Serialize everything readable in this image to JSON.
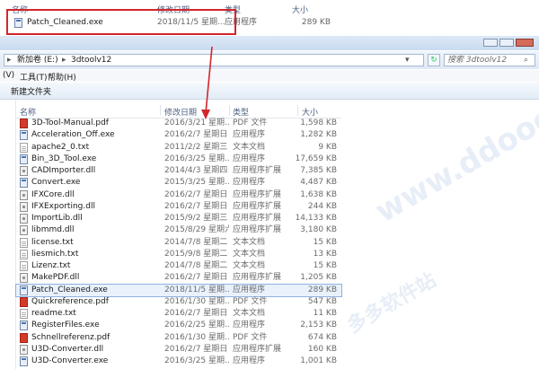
{
  "top_window": {
    "columns": {
      "name": "名称",
      "modified": "修改日期",
      "type": "类型",
      "size": "大小"
    },
    "file": {
      "name": "Patch_Cleaned.exe",
      "modified": "2018/11/5 星期...",
      "type": "应用程序",
      "size": "289 KB",
      "icon": "exe-icon"
    }
  },
  "address_bar": {
    "path": [
      "新加卷 (E:)",
      "3dtoolv12"
    ],
    "search_placeholder": "搜索 3dtoolv12"
  },
  "menu": {
    "view": "(V)",
    "tools": "工具(T)",
    "help": "帮助(H)"
  },
  "toolbar": {
    "new_folder": "新建文件夹"
  },
  "columns": {
    "name": "名称",
    "modified": "修改日期",
    "type": "类型",
    "size": "大小"
  },
  "files": [
    {
      "name": "3D-Tool-Manual.pdf",
      "modified": "2016/3/21 星期...",
      "type": "PDF 文件",
      "size": "1,598 KB",
      "icon": "pdf"
    },
    {
      "name": "Acceleration_Off.exe",
      "modified": "2016/2/7 星期日 ...",
      "type": "应用程序",
      "size": "1,282 KB",
      "icon": "exe"
    },
    {
      "name": "apache2_0.txt",
      "modified": "2011/2/2 星期三 ...",
      "type": "文本文档",
      "size": "9 KB",
      "icon": "txt"
    },
    {
      "name": "Bin_3D_Tool.exe",
      "modified": "2016/3/25 星期...",
      "type": "应用程序",
      "size": "17,659 KB",
      "icon": "exe"
    },
    {
      "name": "CADImporter.dll",
      "modified": "2014/4/3 星期四 ...",
      "type": "应用程序扩展",
      "size": "7,385 KB",
      "icon": "dll"
    },
    {
      "name": "Convert.exe",
      "modified": "2015/3/25 星期...",
      "type": "应用程序",
      "size": "4,487 KB",
      "icon": "exe"
    },
    {
      "name": "IFXCore.dll",
      "modified": "2016/2/7 星期日 ...",
      "type": "应用程序扩展",
      "size": "1,638 KB",
      "icon": "dll"
    },
    {
      "name": "IFXExporting.dll",
      "modified": "2016/2/7 星期日 ...",
      "type": "应用程序扩展",
      "size": "244 KB",
      "icon": "dll"
    },
    {
      "name": "ImportLib.dll",
      "modified": "2015/9/2 星期三 ...",
      "type": "应用程序扩展",
      "size": "14,133 KB",
      "icon": "dll"
    },
    {
      "name": "libmmd.dll",
      "modified": "2015/8/29 星期六 ...",
      "type": "应用程序扩展",
      "size": "3,180 KB",
      "icon": "dll"
    },
    {
      "name": "license.txt",
      "modified": "2014/7/8 星期二 ...",
      "type": "文本文档",
      "size": "15 KB",
      "icon": "txt"
    },
    {
      "name": "liesmich.txt",
      "modified": "2015/9/8 星期二 ...",
      "type": "文本文档",
      "size": "13 KB",
      "icon": "txt"
    },
    {
      "name": "Lizenz.txt",
      "modified": "2014/7/8 星期二 ...",
      "type": "文本文档",
      "size": "15 KB",
      "icon": "txt"
    },
    {
      "name": "MakePDF.dll",
      "modified": "2016/2/7 星期日 ...",
      "type": "应用程序扩展",
      "size": "1,205 KB",
      "icon": "dll"
    },
    {
      "name": "Patch_Cleaned.exe",
      "modified": "2018/11/5 星期...",
      "type": "应用程序",
      "size": "289 KB",
      "icon": "exe",
      "highlighted": true
    },
    {
      "name": "Quickreference.pdf",
      "modified": "2016/1/30 星期...",
      "type": "PDF 文件",
      "size": "547 KB",
      "icon": "pdf"
    },
    {
      "name": "readme.txt",
      "modified": "2016/2/7 星期日 ...",
      "type": "文本文档",
      "size": "11 KB",
      "icon": "txt"
    },
    {
      "name": "RegisterFiles.exe",
      "modified": "2016/2/25 星期...",
      "type": "应用程序",
      "size": "2,153 KB",
      "icon": "exe"
    },
    {
      "name": "Schnellreferenz.pdf",
      "modified": "2016/1/30 星期...",
      "type": "PDF 文件",
      "size": "674 KB",
      "icon": "pdf"
    },
    {
      "name": "U3D-Converter.dll",
      "modified": "2016/2/7 星期日 ...",
      "type": "应用程序扩展",
      "size": "160 KB",
      "icon": "dll"
    },
    {
      "name": "U3D-Converter.exe",
      "modified": "2016/3/25 星期...",
      "type": "应用程序",
      "size": "1,001 KB",
      "icon": "exe"
    }
  ],
  "colors": {
    "highlight_box": "#d3262b",
    "arrow": "#d3262b",
    "selected_bg": "#e9f1fb",
    "selected_border": "#8db2e3"
  },
  "watermark": [
    "www.ddooo.com",
    "多多软件站"
  ]
}
